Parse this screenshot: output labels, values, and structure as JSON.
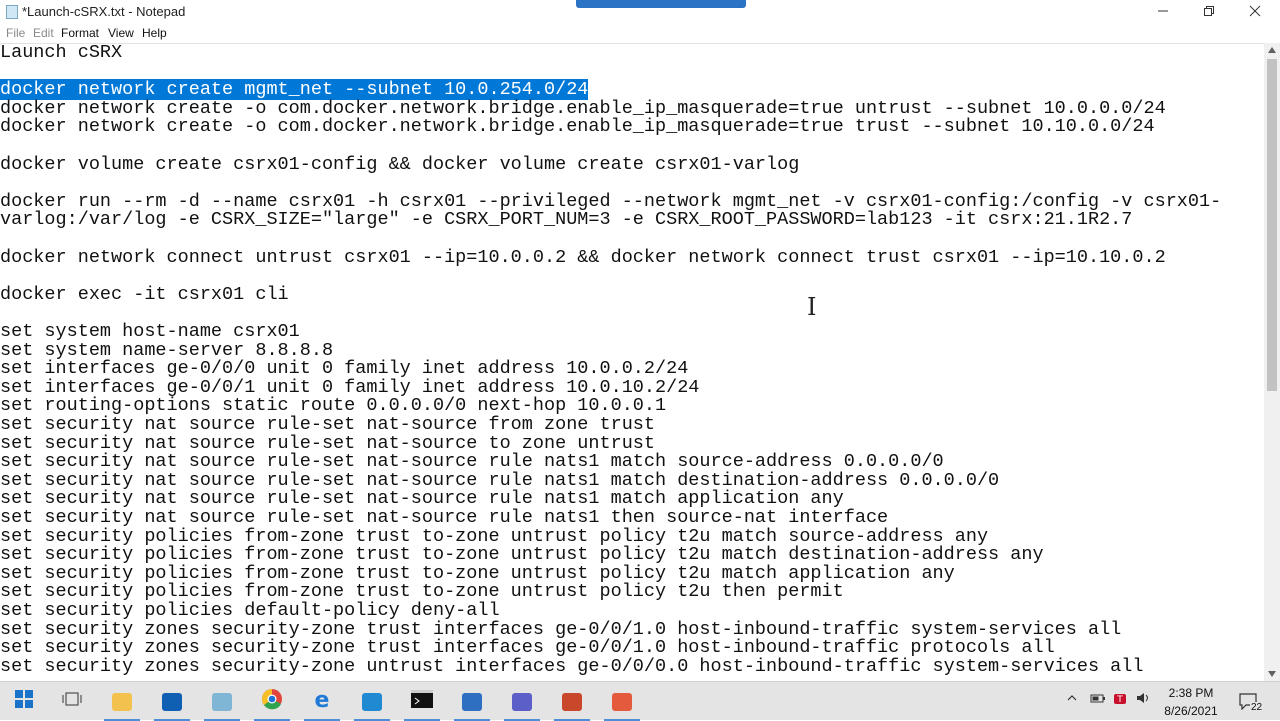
{
  "window": {
    "title": "*Launch-cSRX.txt - Notepad",
    "minimize_icon": "minimize-icon",
    "maximize_icon": "restore-icon",
    "close_icon": "close-icon"
  },
  "menu": {
    "file": "File",
    "edit": "Edit",
    "format": "Format",
    "view": "View",
    "help": "Help"
  },
  "editor": {
    "lines": [
      "Launch cSRX",
      "",
      "docker network create mgmt_net --subnet 10.0.254.0/24",
      "docker network create -o com.docker.network.bridge.enable_ip_masquerade=true untrust --subnet 10.0.0.0/24",
      "docker network create -o com.docker.network.bridge.enable_ip_masquerade=true trust --subnet 10.10.0.0/24",
      "",
      "docker volume create csrx01-config && docker volume create csrx01-varlog",
      "",
      "docker run --rm -d --name csrx01 -h csrx01 --privileged --network mgmt_net -v csrx01-config:/config -v csrx01-",
      "varlog:/var/log -e CSRX_SIZE=\"large\" -e CSRX_PORT_NUM=3 -e CSRX_ROOT_PASSWORD=lab123 -it csrx:21.1R2.7",
      "",
      "docker network connect untrust csrx01 --ip=10.0.0.2 && docker network connect trust csrx01 --ip=10.10.0.2",
      "",
      "docker exec -it csrx01 cli",
      "",
      "set system host-name csrx01",
      "set system name-server 8.8.8.8",
      "set interfaces ge-0/0/0 unit 0 family inet address 10.0.0.2/24",
      "set interfaces ge-0/0/1 unit 0 family inet address 10.0.10.2/24",
      "set routing-options static route 0.0.0.0/0 next-hop 10.0.0.1",
      "set security nat source rule-set nat-source from zone trust",
      "set security nat source rule-set nat-source to zone untrust",
      "set security nat source rule-set nat-source rule nats1 match source-address 0.0.0.0/0",
      "set security nat source rule-set nat-source rule nats1 match destination-address 0.0.0.0/0",
      "set security nat source rule-set nat-source rule nats1 match application any",
      "set security nat source rule-set nat-source rule nats1 then source-nat interface",
      "set security policies from-zone trust to-zone untrust policy t2u match source-address any",
      "set security policies from-zone trust to-zone untrust policy t2u match destination-address any",
      "set security policies from-zone trust to-zone untrust policy t2u match application any",
      "set security policies from-zone trust to-zone untrust policy t2u then permit",
      "set security policies default-policy deny-all",
      "set security zones security-zone trust interfaces ge-0/0/1.0 host-inbound-traffic system-services all",
      "set security zones security-zone trust interfaces ge-0/0/1.0 host-inbound-traffic protocols all",
      "set security zones security-zone untrust interfaces ge-0/0/0.0 host-inbound-traffic system-services all"
    ],
    "selected_line_index": 2,
    "selection_color": "#0078d7"
  },
  "taskbar": {
    "apps": [
      {
        "icon": "windows-start-icon",
        "color": "#1a73c9"
      },
      {
        "icon": "task-view-icon",
        "color": "#333333"
      },
      {
        "icon": "file-explorer-icon",
        "color": "#f2c14e"
      },
      {
        "icon": "outlook-icon",
        "color": "#0f5fb3"
      },
      {
        "icon": "notepad-icon",
        "color": "#7fb6d6"
      },
      {
        "icon": "chrome-icon",
        "color": "#e0463b"
      },
      {
        "icon": "edge-icon",
        "color": "#1e7ad6"
      },
      {
        "icon": "vscode-icon",
        "color": "#1f8ad2"
      },
      {
        "icon": "terminal-icon",
        "color": "#111111"
      },
      {
        "icon": "sublime-icon",
        "color": "#2e6fc2"
      },
      {
        "icon": "teams-icon",
        "color": "#5b5fc7"
      },
      {
        "icon": "powerpoint-icon",
        "color": "#c9472b"
      },
      {
        "icon": "draw-app-icon",
        "color": "#e45a3c"
      }
    ],
    "tray_icons": [
      "chevron-up-icon",
      "battery-icon",
      "network-icon",
      "volume-icon"
    ],
    "time": "2:38 PM",
    "date": "8/26/2021",
    "notification_count": "22"
  }
}
